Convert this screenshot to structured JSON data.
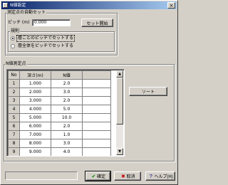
{
  "window": {
    "title": "N値設定"
  },
  "groups": {
    "auto": {
      "label": "測定点の自動セット",
      "pitch_label": "ピッチ (m)",
      "pitch_value": "0.000",
      "start_button": "セット開始",
      "method": {
        "label": "規則",
        "options": [
          {
            "label": "層ごとのピッチでセットする",
            "selected": true
          },
          {
            "label": "層全体をピッチでセットする",
            "selected": false
          }
        ]
      }
    },
    "points": {
      "label": "N値測定点",
      "sort_button": "ソート",
      "columns": [
        "No",
        "深さ(m)",
        "N値",
        ""
      ],
      "rows": [
        {
          "no": "1",
          "depth": "1.000",
          "n": "2.0"
        },
        {
          "no": "2",
          "depth": "2.000",
          "n": "3.0"
        },
        {
          "no": "3",
          "depth": "3.000",
          "n": "2.0"
        },
        {
          "no": "4",
          "depth": "4.000",
          "n": "5.0"
        },
        {
          "no": "5",
          "depth": "5.000",
          "n": "10.0"
        },
        {
          "no": "6",
          "depth": "6.000",
          "n": "2.0"
        },
        {
          "no": "7",
          "depth": "7.000",
          "n": "1.0"
        },
        {
          "no": "8",
          "depth": "8.000",
          "n": "3.0"
        },
        {
          "no": "9",
          "depth": "9.000",
          "n": "4.0"
        }
      ]
    }
  },
  "footer": {
    "ok_label": "確定",
    "ok_icon": "✔",
    "cancel_label": "取消",
    "cancel_icon": "✖",
    "help_label": "ヘルプ(H)",
    "help_icon": "?"
  },
  "colors": {
    "face": "#d4d0c8",
    "title_start": "#0a246a",
    "title_end": "#a6caf0",
    "ok_icon": "#008000",
    "cancel_icon": "#c00000"
  }
}
